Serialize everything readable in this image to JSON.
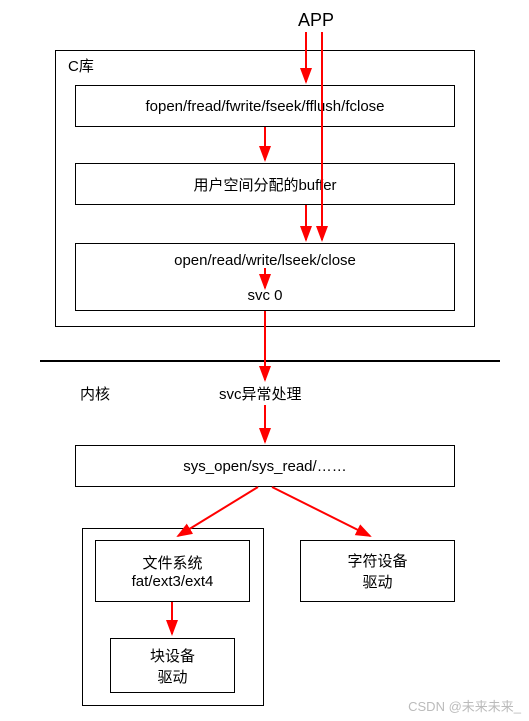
{
  "top_label": "APP",
  "clib": {
    "title": "C库",
    "box1": "fopen/fread/fwrite/fseek/fflush/fclose",
    "box2": "用户空间分配的buffer",
    "box3_line1": "open/read/write/lseek/close",
    "box3_line2": "svc 0"
  },
  "kernel": {
    "title": "内核",
    "svc_label": "svc异常处理",
    "syscalls": "sys_open/sys_read/……",
    "fs_line1": "文件系统",
    "fs_line2": "fat/ext3/ext4",
    "chardev_line1": "字符设备",
    "chardev_line2": "驱动",
    "blockdev_line1": "块设备",
    "blockdev_line2": "驱动"
  },
  "watermark": "CSDN @未来未来_",
  "chart_data": {
    "type": "diagram",
    "title": "Linux file access call path from APP through C library into kernel",
    "nodes": [
      {
        "id": "app",
        "label": "APP"
      },
      {
        "id": "clib",
        "label": "C库",
        "children": [
          "libc_funcs",
          "user_buffer",
          "low_funcs"
        ]
      },
      {
        "id": "libc_funcs",
        "label": "fopen/fread/fwrite/fseek/fflush/fclose"
      },
      {
        "id": "user_buffer",
        "label": "用户空间分配的buffer"
      },
      {
        "id": "low_funcs",
        "label": "open/read/write/lseek/close",
        "sub": "svc 0"
      },
      {
        "id": "svc_handler",
        "label": "svc异常处理"
      },
      {
        "id": "syscalls",
        "label": "sys_open/sys_read/……"
      },
      {
        "id": "fs",
        "label": "文件系统 fat/ext3/ext4"
      },
      {
        "id": "chardev",
        "label": "字符设备 驱动"
      },
      {
        "id": "blockdev",
        "label": "块设备 驱动"
      }
    ],
    "edges": [
      {
        "from": "app",
        "to": "libc_funcs"
      },
      {
        "from": "app",
        "to": "low_funcs"
      },
      {
        "from": "libc_funcs",
        "to": "user_buffer"
      },
      {
        "from": "user_buffer",
        "to": "low_funcs"
      },
      {
        "from": "low_funcs",
        "to": "svc_handler",
        "note": "svc 0"
      },
      {
        "from": "svc_handler",
        "to": "syscalls"
      },
      {
        "from": "syscalls",
        "to": "fs"
      },
      {
        "from": "syscalls",
        "to": "chardev"
      },
      {
        "from": "fs",
        "to": "blockdev"
      }
    ],
    "boundary": {
      "user_space": [
        "clib"
      ],
      "kernel_space": [
        "svc_handler",
        "syscalls",
        "fs",
        "chardev",
        "blockdev"
      ]
    }
  }
}
